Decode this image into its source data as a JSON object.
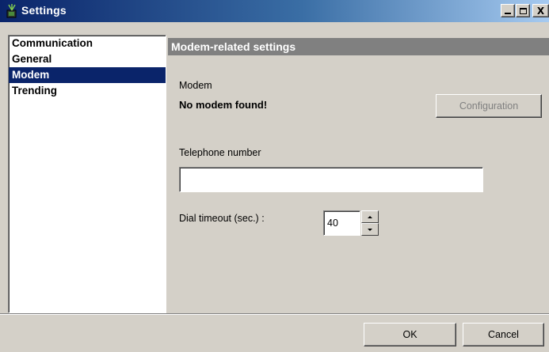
{
  "window": {
    "title": "Settings",
    "icon": "app-icon",
    "controls": {
      "minimize": "_",
      "maximize": "□",
      "close": "X"
    }
  },
  "nav": {
    "items": [
      {
        "label": "Communication",
        "selected": false
      },
      {
        "label": "General",
        "selected": false
      },
      {
        "label": "Modem",
        "selected": true
      },
      {
        "label": "Trending",
        "selected": false
      }
    ]
  },
  "content": {
    "header": "Modem-related settings",
    "modem_label": "Modem",
    "modem_status": "No modem found!",
    "configuration_button": "Configuration",
    "phone_label": "Telephone number",
    "phone_value": "",
    "timeout_label": "Dial timeout (sec.) :",
    "timeout_value": "40"
  },
  "footer": {
    "ok_button": "OK",
    "cancel_button": "Cancel"
  },
  "colors": {
    "title_bar": "#0a246a",
    "selection": "#0a246a",
    "header_bar": "#808080",
    "face": "#d4d0c8"
  }
}
